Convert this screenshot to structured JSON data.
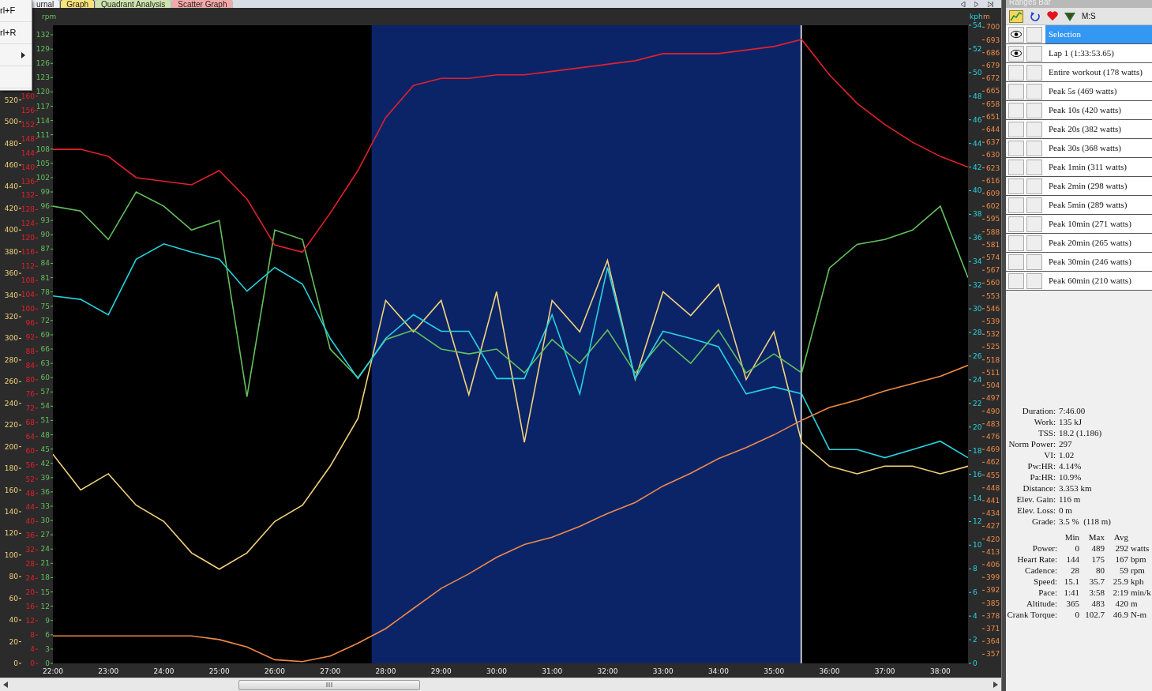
{
  "menu": {
    "items": [
      {
        "kind": "shortcut",
        "label": "rl+F"
      },
      {
        "kind": "shortcut",
        "label": "rl+R"
      },
      {
        "kind": "submenu"
      },
      {
        "kind": "blank"
      }
    ]
  },
  "tabs": [
    {
      "label": "urnal",
      "selected": false,
      "color": "#eef0f4"
    },
    {
      "label": "Graph",
      "selected": true,
      "color": "#f7e37a"
    },
    {
      "label": "Quadrant Analysis",
      "selected": false,
      "color": "#cfe3b0"
    },
    {
      "label": "Scatter Graph",
      "selected": false,
      "color": "#f4a9a9"
    }
  ],
  "left_axes_chart": {
    "chart_data": {
      "type": "line",
      "xlim": [
        22,
        38.5
      ],
      "x": [
        22,
        22.5,
        23,
        23.5,
        24,
        24.5,
        25,
        25.5,
        26,
        26.5,
        27,
        27.5,
        28,
        28.5,
        29,
        29.5,
        30,
        30.5,
        31,
        31.5,
        32,
        32.5,
        33,
        33.5,
        34,
        34.5,
        35,
        35.5,
        36,
        36.5,
        37,
        37.5,
        38,
        38.5
      ],
      "xticks": [
        {
          "value": 22,
          "label": "22:00"
        },
        {
          "value": 23,
          "label": "23:00"
        },
        {
          "value": 24,
          "label": "24:00"
        },
        {
          "value": 25,
          "label": "25:00"
        },
        {
          "value": 26,
          "label": "26:00"
        },
        {
          "value": 27,
          "label": "27:00"
        },
        {
          "value": 28,
          "label": "28:00"
        },
        {
          "value": 29,
          "label": "29:00"
        },
        {
          "value": 30,
          "label": "30:00"
        },
        {
          "value": 31,
          "label": "31:00"
        },
        {
          "value": 32,
          "label": "32:00"
        },
        {
          "value": 33,
          "label": "33:00"
        },
        {
          "value": 34,
          "label": "34:00"
        },
        {
          "value": 35,
          "label": "35:00"
        },
        {
          "value": 36,
          "label": "36:00"
        },
        {
          "value": 37,
          "label": "37:00"
        },
        {
          "value": 38,
          "label": "38:00"
        }
      ],
      "ref_lines": [
        {
          "axis": "x",
          "value": 35.5,
          "color": "#ffffff"
        }
      ],
      "ylim": [
        0,
        589
      ],
      "yticks": [
        0,
        20,
        40,
        60,
        80,
        100,
        120,
        140,
        160,
        180,
        200,
        220,
        240,
        260,
        280,
        300,
        320,
        340,
        360,
        380,
        400,
        420,
        440,
        460,
        480,
        500,
        520
      ],
      "y2lim": [
        0,
        180
      ],
      "y2ticks": [
        0,
        4,
        8,
        12,
        16,
        20,
        24,
        28,
        32,
        36,
        40,
        44,
        48,
        52,
        56,
        60,
        64,
        68,
        72,
        76,
        80,
        84,
        88,
        92,
        96,
        100,
        104,
        108,
        112,
        116,
        120,
        124,
        128,
        132,
        136,
        140,
        144,
        148,
        152,
        156,
        160
      ],
      "y3label": "rpm",
      "y3lim": [
        0,
        134
      ],
      "y3ticks": [
        0,
        3,
        6,
        9,
        12,
        15,
        18,
        21,
        24,
        27,
        30,
        33,
        36,
        39,
        42,
        45,
        48,
        51,
        54,
        57,
        60,
        63,
        66,
        69,
        72,
        75,
        78,
        81,
        84,
        87,
        90,
        93,
        96,
        99,
        102,
        105,
        108,
        111,
        114,
        117,
        120,
        123,
        126,
        129,
        132
      ],
      "series": [
        {
          "color": "#f3d27a",
          "values": [
            193,
            160,
            175,
            146,
            131,
            102,
            87,
            102,
            131,
            146,
            182,
            226,
            335,
            306,
            335,
            248,
            343,
            204,
            335,
            306,
            372,
            262,
            343,
            321,
            350,
            262,
            306,
            204,
            182,
            175,
            182,
            182,
            175,
            182
          ]
        },
        {
          "color": "#63c05c",
          "axis": "y3",
          "values": [
            96,
            95,
            89,
            99,
            96,
            91,
            93,
            56,
            91,
            89,
            66,
            60,
            68,
            70,
            66,
            65,
            66,
            61,
            68,
            63,
            70,
            61,
            68,
            63,
            70,
            61,
            65,
            61,
            83,
            88,
            89,
            91,
            96,
            81
          ]
        },
        {
          "color": "#e3202c",
          "axis": "y2",
          "values": [
            145,
            145,
            143,
            137,
            136,
            135,
            139,
            131,
            118,
            116,
            127,
            139,
            154,
            163,
            165,
            165,
            166,
            166,
            167,
            168,
            169,
            170,
            172,
            172,
            172,
            173,
            174,
            176,
            166,
            158,
            152,
            147,
            143,
            140
          ]
        }
      ]
    }
  },
  "right_axes_chart": {
    "chart_data": {
      "type": "line",
      "xlim": [
        22,
        38.5
      ],
      "x": [
        22,
        22.5,
        23,
        23.5,
        24,
        24.5,
        25,
        25.5,
        26,
        26.5,
        27,
        27.5,
        28,
        28.5,
        29,
        29.5,
        30,
        30.5,
        31,
        31.5,
        32,
        32.5,
        33,
        33.5,
        34,
        34.5,
        35,
        35.5,
        36,
        36.5,
        37,
        37.5,
        38,
        38.5
      ],
      "ylabel": "kph",
      "ylim": [
        0,
        54
      ],
      "yticks": [
        0,
        2,
        4,
        6,
        8,
        10,
        12,
        14,
        16,
        18,
        20,
        22,
        24,
        26,
        28,
        30,
        32,
        34,
        36,
        38,
        40,
        42,
        44,
        46,
        48,
        50,
        52,
        54
      ],
      "y2label": "m",
      "y2lim": [
        352,
        701
      ],
      "y2ticks": [
        357,
        364,
        371,
        378,
        385,
        392,
        399,
        406,
        413,
        420,
        427,
        434,
        441,
        448,
        455,
        462,
        469,
        476,
        483,
        490,
        497,
        504,
        511,
        518,
        525,
        532,
        539,
        546,
        553,
        560,
        567,
        574,
        581,
        588,
        595,
        602,
        609,
        616,
        623,
        630,
        637,
        644,
        651,
        658,
        665,
        672,
        679,
        686,
        693,
        700
      ],
      "series": [
        {
          "color": "#26d3e0",
          "values": [
            31.1,
            30.8,
            29.5,
            34.2,
            35.5,
            34.8,
            34.2,
            31.5,
            33.5,
            32.1,
            27.5,
            24.1,
            27.5,
            29.5,
            28.1,
            28.1,
            24.1,
            24.1,
            29.5,
            22.8,
            33.5,
            24.1,
            28.1,
            27.5,
            26.8,
            22.8,
            23.4,
            22.8,
            18.1,
            18.1,
            17.4,
            18.1,
            18.8,
            17.4
          ]
        },
        {
          "color": "#f08a48",
          "axis": "y2",
          "values": [
            367,
            367,
            367,
            367,
            367,
            367,
            365,
            361,
            354,
            353,
            356,
            363,
            371,
            382,
            393,
            401,
            410,
            417,
            421,
            427,
            434,
            440,
            449,
            456,
            464,
            470,
            477,
            485,
            492,
            496,
            501,
            505,
            509,
            515
          ]
        }
      ]
    }
  },
  "ranges": {
    "title": "Ranges Bar",
    "toolbar_label": "M:S",
    "items": [
      {
        "label": "Selection",
        "selected": true,
        "visible": true,
        "checked": false
      },
      {
        "label": "Lap 1 (1:33:53.65)",
        "selected": false,
        "visible": true,
        "checked": false
      },
      {
        "label": "Entire workout (178 watts)",
        "selected": false,
        "visible": false,
        "checked": false
      },
      {
        "label": "Peak 5s (469 watts)",
        "selected": false,
        "visible": false,
        "checked": false
      },
      {
        "label": "Peak 10s (420 watts)",
        "selected": false,
        "visible": false,
        "checked": false
      },
      {
        "label": "Peak 20s (382 watts)",
        "selected": false,
        "visible": false,
        "checked": false
      },
      {
        "label": "Peak 30s (368 watts)",
        "selected": false,
        "visible": false,
        "checked": false
      },
      {
        "label": "Peak 1min (311 watts)",
        "selected": false,
        "visible": false,
        "checked": false
      },
      {
        "label": "Peak 2min (298 watts)",
        "selected": false,
        "visible": false,
        "checked": false
      },
      {
        "label": "Peak 5min (289 watts)",
        "selected": false,
        "visible": false,
        "checked": false
      },
      {
        "label": "Peak 10min (271 watts)",
        "selected": false,
        "visible": false,
        "checked": false
      },
      {
        "label": "Peak 20min (265 watts)",
        "selected": false,
        "visible": false,
        "checked": false
      },
      {
        "label": "Peak 30min (246 watts)",
        "selected": false,
        "visible": false,
        "checked": false
      },
      {
        "label": "Peak 60min (210 watts)",
        "selected": false,
        "visible": false,
        "checked": false
      }
    ]
  },
  "stats": [
    {
      "label": "Duration:",
      "value": "7:46.00"
    },
    {
      "label": "Work:",
      "value": "135 kJ"
    },
    {
      "label": "TSS:",
      "value": "18.2 (1.186)"
    },
    {
      "label": "Norm Power:",
      "value": "297"
    },
    {
      "label": "VI:",
      "value": "1.02"
    },
    {
      "label": "Pw:HR:",
      "value": "4.14%"
    },
    {
      "label": "Pa:HR:",
      "value": "10.9%"
    },
    {
      "label": "Distance:",
      "value": "3.353 km"
    },
    {
      "label": "Elev. Gain:",
      "value": "116 m"
    },
    {
      "label": "Elev. Loss:",
      "value": "0 m"
    },
    {
      "label": "Grade:",
      "value": "3.5 %  (118 m)"
    }
  ],
  "summary": {
    "columns": [
      "Min",
      "Max",
      "Avg"
    ],
    "rows": [
      {
        "label": "Power:",
        "min": "0",
        "max": "489",
        "avg": "292",
        "unit": "watts"
      },
      {
        "label": "Heart Rate:",
        "min": "144",
        "max": "175",
        "avg": "167",
        "unit": "bpm"
      },
      {
        "label": "Cadence:",
        "min": "28",
        "max": "80",
        "avg": "59",
        "unit": "rpm"
      },
      {
        "label": "Speed:",
        "min": "15.1",
        "max": "35.7",
        "avg": "25.9",
        "unit": "kph"
      },
      {
        "label": "Pace:",
        "min": "1:41",
        "max": "3:58",
        "avg": "2:19",
        "unit": "min/k"
      },
      {
        "label": "Altitude:",
        "min": "365",
        "max": "483",
        "avg": "420",
        "unit": "m"
      },
      {
        "label": "Crank Torque:",
        "min": "0",
        "max": "102.7",
        "avg": "46.9",
        "unit": "N-m"
      }
    ]
  }
}
